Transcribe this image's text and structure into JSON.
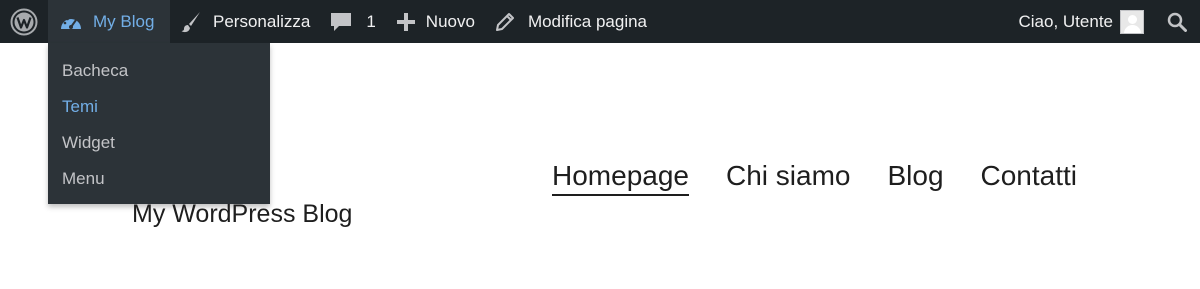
{
  "adminbar": {
    "site_name": "My Blog",
    "customize": "Personalizza",
    "comments_count": "1",
    "new": "Nuovo",
    "edit_page": "Modifica pagina",
    "greeting": "Ciao, Utente"
  },
  "site_menu": {
    "items": [
      "Bacheca",
      "Temi",
      "Widget",
      "Menu"
    ],
    "active_item": "Temi"
  },
  "site": {
    "title": "My WordPress Blog",
    "nav": [
      "Homepage",
      "Chi siamo",
      "Blog",
      "Contatti"
    ],
    "current_nav": "Homepage"
  },
  "colors": {
    "adminbar_bg": "#1d2327",
    "submenu_bg": "#2c3338",
    "accent": "#72aee6",
    "text_dark": "#1e1e1e"
  },
  "icons": [
    "wordpress-logo-icon",
    "dashboard-icon",
    "paintbrush-icon",
    "comment-icon",
    "plus-icon",
    "pencil-icon",
    "avatar",
    "search-icon"
  ]
}
